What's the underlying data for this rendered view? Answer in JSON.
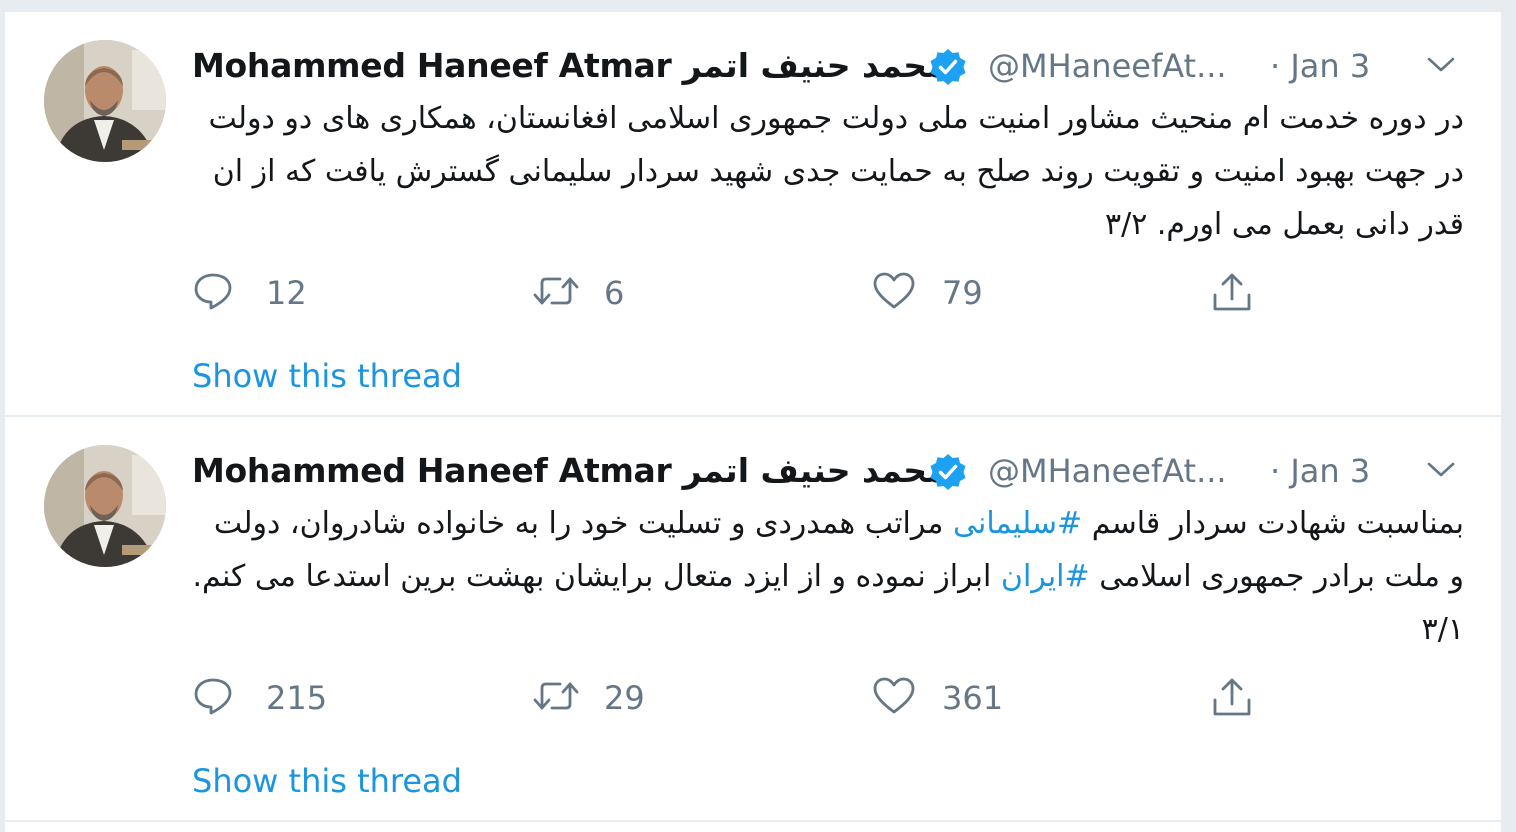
{
  "colors": {
    "text": "#14171a",
    "secondary": "#657786",
    "link": "#1b95e0",
    "border": "#e6ecf0",
    "verified": "#1da1f2"
  },
  "tweets": [
    {
      "author_name": "Mohammed Haneef Atmar محمد حنیف اتمر",
      "handle": "@MHaneefAt...",
      "time": "· Jan 3",
      "text_parts": [
        {
          "text": "در دوره خدمت ام منحیث مشاور امنیت ملی دولت جمهوری اسلامی افغانستان، همکاری های دو دولت در جهت بهبود امنیت و تقویت روند صلح به حمایت جدی شهید سردار سلیمانی گسترش یافت که از ان قدر دانی بعمل می اورم. ۳/۲"
        }
      ],
      "replies": "12",
      "retweets": "6",
      "likes": "79",
      "show_thread": "Show this thread",
      "icons": {
        "reply": "reply-icon",
        "retweet": "retweet-icon",
        "like": "heart-icon",
        "share": "share-icon"
      }
    },
    {
      "author_name": "Mohammed Haneef Atmar محمد حنیف اتمر",
      "handle": "@MHaneefAt...",
      "time": "· Jan 3",
      "text_parts": [
        {
          "text": "بمناسبت شهادت سردار قاسم "
        },
        {
          "text": "#سلیمانی",
          "hashtag": true
        },
        {
          "text": " مراتب همدردی و تسلیت خود را به خانواده شادروان، دولت و ملت برادر جمهوری اسلامی "
        },
        {
          "text": "#ایران",
          "hashtag": true
        },
        {
          "text": " ابراز نموده و از ایزد متعال برایشان بهشت برین استدعا می کنم. ۳/۱"
        }
      ],
      "replies": "215",
      "retweets": "29",
      "likes": "361",
      "show_thread": "Show this thread",
      "icons": {
        "reply": "reply-icon",
        "retweet": "retweet-icon",
        "like": "heart-icon",
        "share": "share-icon"
      }
    }
  ]
}
